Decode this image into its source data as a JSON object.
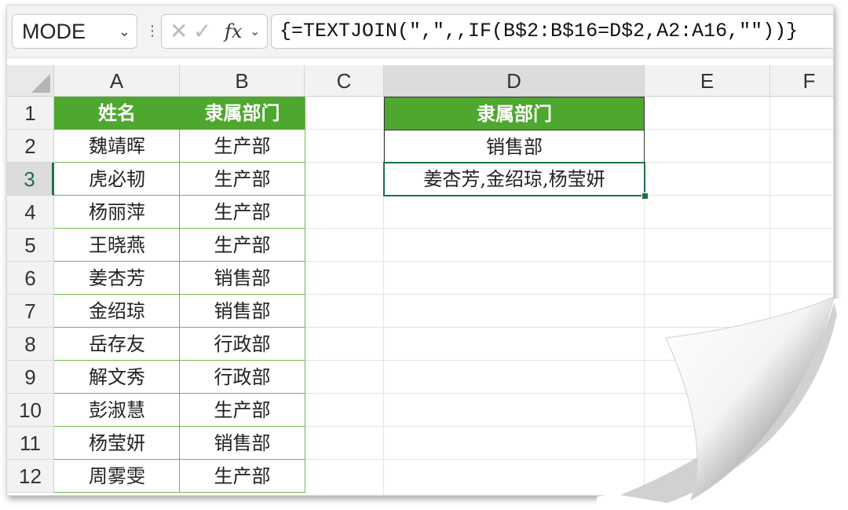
{
  "formula_bar": {
    "name_box": "MODE",
    "name_box_chevron": "chevron-down-icon",
    "cancel_glyph": "✕",
    "enter_glyph": "✓",
    "fx_label": "fx",
    "formula": "{=TEXTJOIN(\",\",,IF(B$2:B$16=D$2,A2:A16,\"\"))}"
  },
  "columns": [
    "A",
    "B",
    "C",
    "D",
    "E",
    "F"
  ],
  "rows": [
    "1",
    "2",
    "3",
    "4",
    "5",
    "6",
    "7",
    "8",
    "9",
    "10",
    "11",
    "12"
  ],
  "table": {
    "header_name": "姓名",
    "header_dept": "隶属部门",
    "records": [
      {
        "name": "魏靖晖",
        "dept": "生产部"
      },
      {
        "name": "虎必韧",
        "dept": "生产部"
      },
      {
        "name": "杨丽萍",
        "dept": "生产部"
      },
      {
        "name": "王晓燕",
        "dept": "生产部"
      },
      {
        "name": "姜杏芳",
        "dept": "销售部"
      },
      {
        "name": "金绍琼",
        "dept": "销售部"
      },
      {
        "name": "岳存友",
        "dept": "行政部"
      },
      {
        "name": "解文秀",
        "dept": "行政部"
      },
      {
        "name": "彭淑慧",
        "dept": "生产部"
      },
      {
        "name": "杨莹妍",
        "dept": "销售部"
      },
      {
        "name": "周雾雯",
        "dept": "生产部"
      }
    ]
  },
  "lookup": {
    "header": "隶属部门",
    "criteria": "销售部",
    "result": "姜杏芳,金绍琼,杨莹妍"
  },
  "colors": {
    "header_green": "#4ea72e",
    "selection_green": "#1e7145",
    "table_border": "#6cba4d"
  }
}
